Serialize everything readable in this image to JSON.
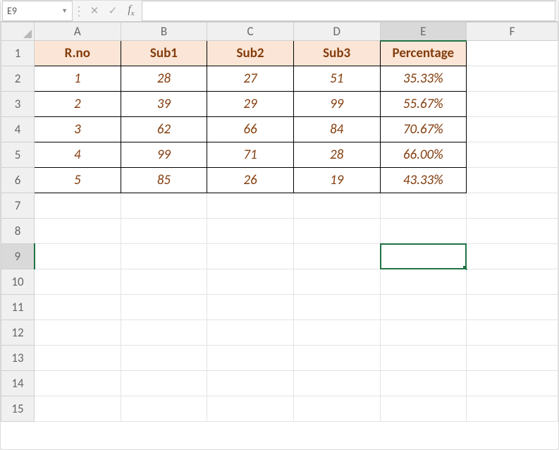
{
  "namebox": {
    "value": "E9"
  },
  "formula": {
    "value": ""
  },
  "columns": [
    "A",
    "B",
    "C",
    "D",
    "E",
    "F"
  ],
  "row_labels": [
    "1",
    "2",
    "3",
    "4",
    "5",
    "6",
    "7",
    "8",
    "9",
    "10",
    "11",
    "12",
    "13",
    "14",
    "15"
  ],
  "selected": {
    "col": "E",
    "row": "9"
  },
  "headers": {
    "A": "R.no",
    "B": "Sub1",
    "C": "Sub2",
    "D": "Sub3",
    "E": "Percentage"
  },
  "rows": [
    {
      "A": "1",
      "B": "28",
      "C": "27",
      "D": "51",
      "E": "35.33%"
    },
    {
      "A": "2",
      "B": "39",
      "C": "29",
      "D": "99",
      "E": "55.67%"
    },
    {
      "A": "3",
      "B": "62",
      "C": "66",
      "D": "84",
      "E": "70.67%"
    },
    {
      "A": "4",
      "B": "99",
      "C": "71",
      "D": "28",
      "E": "66.00%"
    },
    {
      "A": "5",
      "B": "85",
      "C": "26",
      "D": "19",
      "E": "43.33%"
    }
  ],
  "chart_data": {
    "type": "table",
    "title": "",
    "columns": [
      "R.no",
      "Sub1",
      "Sub2",
      "Sub3",
      "Percentage"
    ],
    "rows": [
      [
        1,
        28,
        27,
        51,
        "35.33%"
      ],
      [
        2,
        39,
        29,
        99,
        "55.67%"
      ],
      [
        3,
        62,
        66,
        84,
        "70.67%"
      ],
      [
        4,
        99,
        71,
        28,
        "66.00%"
      ],
      [
        5,
        85,
        26,
        19,
        "43.33%"
      ]
    ]
  }
}
